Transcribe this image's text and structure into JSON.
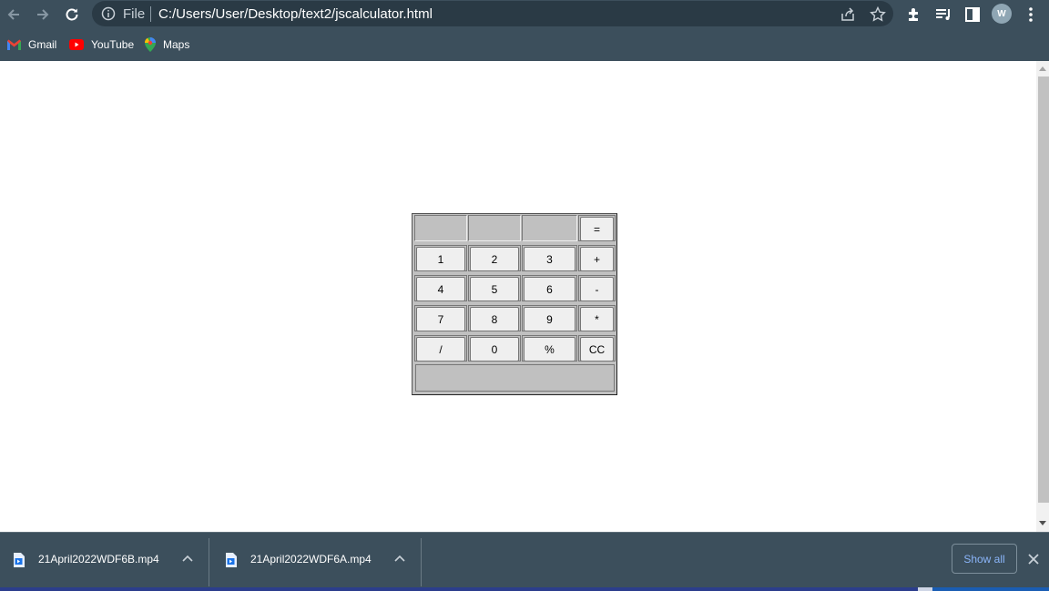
{
  "toolbar": {
    "omnibox": {
      "scheme_label": "File",
      "url": "C:/Users/User/Desktop/text2/jscalculator.html"
    },
    "profile_initial": "W"
  },
  "bookmarks": [
    {
      "label": "Gmail",
      "icon": "gmail-icon"
    },
    {
      "label": "YouTube",
      "icon": "youtube-icon"
    },
    {
      "label": "Maps",
      "icon": "maps-icon"
    }
  ],
  "calculator": {
    "top_row_key": "=",
    "rows": [
      [
        "1",
        "2",
        "3",
        "+"
      ],
      [
        "4",
        "5",
        "6",
        "-"
      ],
      [
        "7",
        "8",
        "9",
        "*"
      ],
      [
        "/",
        "0",
        "%",
        "CC"
      ]
    ],
    "display_value": ""
  },
  "downloads": {
    "items": [
      {
        "filename": "21April2022WDF6B.mp4"
      },
      {
        "filename": "21April2022WDF6A.mp4"
      }
    ],
    "show_all_label": "Show all"
  },
  "colors": {
    "chrome_frame": "#3c4f5c",
    "omnibox_bg": "#2a3a45",
    "calc_bg": "#c0c0c0",
    "key_bg": "#efefef",
    "link_blue": "#8ab4f8"
  }
}
